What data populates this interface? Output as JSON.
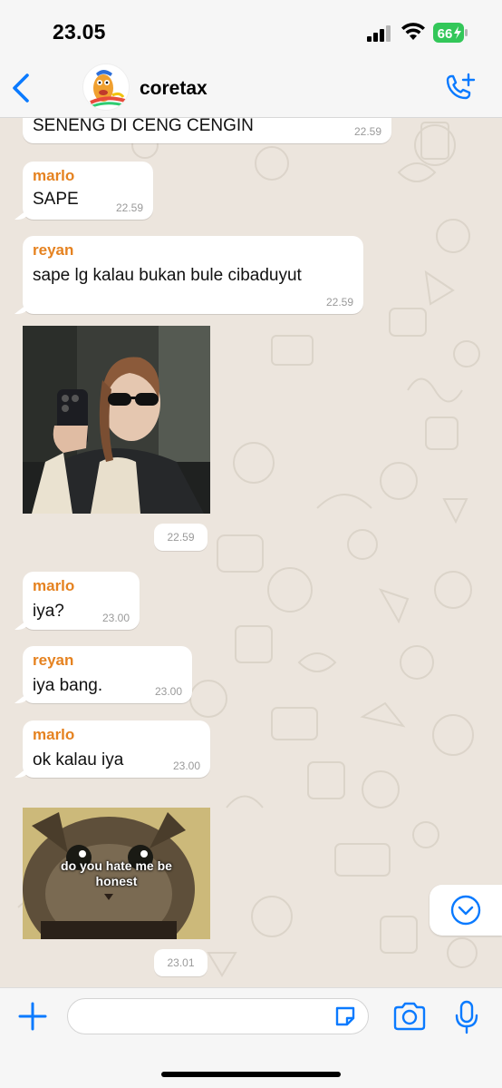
{
  "status": {
    "time": "23.05",
    "battery": "66"
  },
  "header": {
    "chat_name": "coretax",
    "avatar_text": "Magic Jar"
  },
  "colors": {
    "accent": "#0a7aff",
    "sender_name": "#e58220",
    "chat_bg": "#ece5dd",
    "bubble": "#ffffff"
  },
  "messages": [
    {
      "sender": "",
      "text": "SENENG DI CENG CENGIN",
      "time": "22.59"
    },
    {
      "sender": "marlo",
      "text": "SAPE",
      "time": "22.59"
    },
    {
      "sender": "reyan",
      "text": "sape lg kalau bukan bule cibaduyut",
      "time": "22.59"
    },
    {
      "type": "image",
      "description_icon": "photo-woman-mirror-selfie",
      "time": "22.59"
    },
    {
      "sender": "marlo",
      "text": "iya?",
      "time": "23.00"
    },
    {
      "sender": "reyan",
      "text": "iya bang.",
      "time": "23.00"
    },
    {
      "sender": "marlo",
      "text": "ok kalau iya",
      "time": "23.00"
    },
    {
      "type": "image",
      "caption": "do you hate me be honest",
      "time": "23.01"
    }
  ],
  "input": {
    "placeholder": "",
    "value": ""
  },
  "icons": [
    "back-chevron-icon",
    "add-call-icon",
    "plus-icon",
    "sticker-icon",
    "camera-icon",
    "mic-icon",
    "chevron-down-icon"
  ]
}
